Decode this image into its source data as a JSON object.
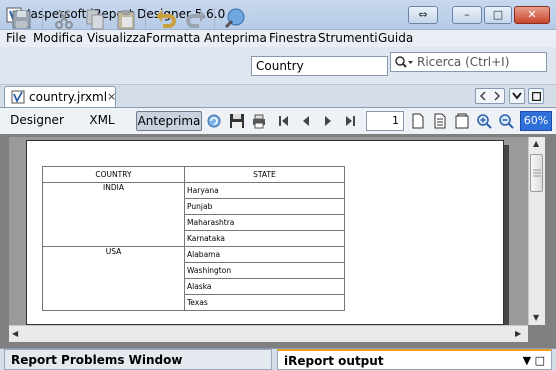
{
  "window": {
    "title": "Jaspersoft iReport Designer 5.6.0",
    "restore_glyph": "⇔",
    "minimize_glyph": "–",
    "maximize_glyph": "□",
    "close_glyph": "✕"
  },
  "menu": [
    "File",
    "Modifica",
    "Visualizza",
    "Formatta",
    "Anteprima",
    "Finestra",
    "Strumenti",
    "Guida"
  ],
  "toolbar": {
    "datasource": "Country",
    "search_placeholder": "Ricerca (Ctrl+I)"
  },
  "tabs": {
    "document": "country.jrxml",
    "close_glyph": "×"
  },
  "editor": {
    "views": [
      "Designer",
      "XML",
      "Anteprima"
    ],
    "active_view": "Anteprima",
    "page_number": "1",
    "zoom": "60%"
  },
  "report": {
    "headers": [
      "COUNTRY",
      "STATE"
    ],
    "groups": [
      {
        "country": "INDIA",
        "states": [
          "Haryana",
          "Punjab",
          "Maharashtra",
          "Karnataka"
        ]
      },
      {
        "country": "USA",
        "states": [
          "Alabama",
          "Washington",
          "Alaska",
          "Texas"
        ]
      }
    ]
  },
  "bottom": {
    "left_tab": "Report Problems Window",
    "right_tab": "iReport output",
    "right_icons": "▼ □"
  },
  "colors": {
    "accent": "#2f6fd8",
    "active_tab_border": "#f0a020"
  }
}
